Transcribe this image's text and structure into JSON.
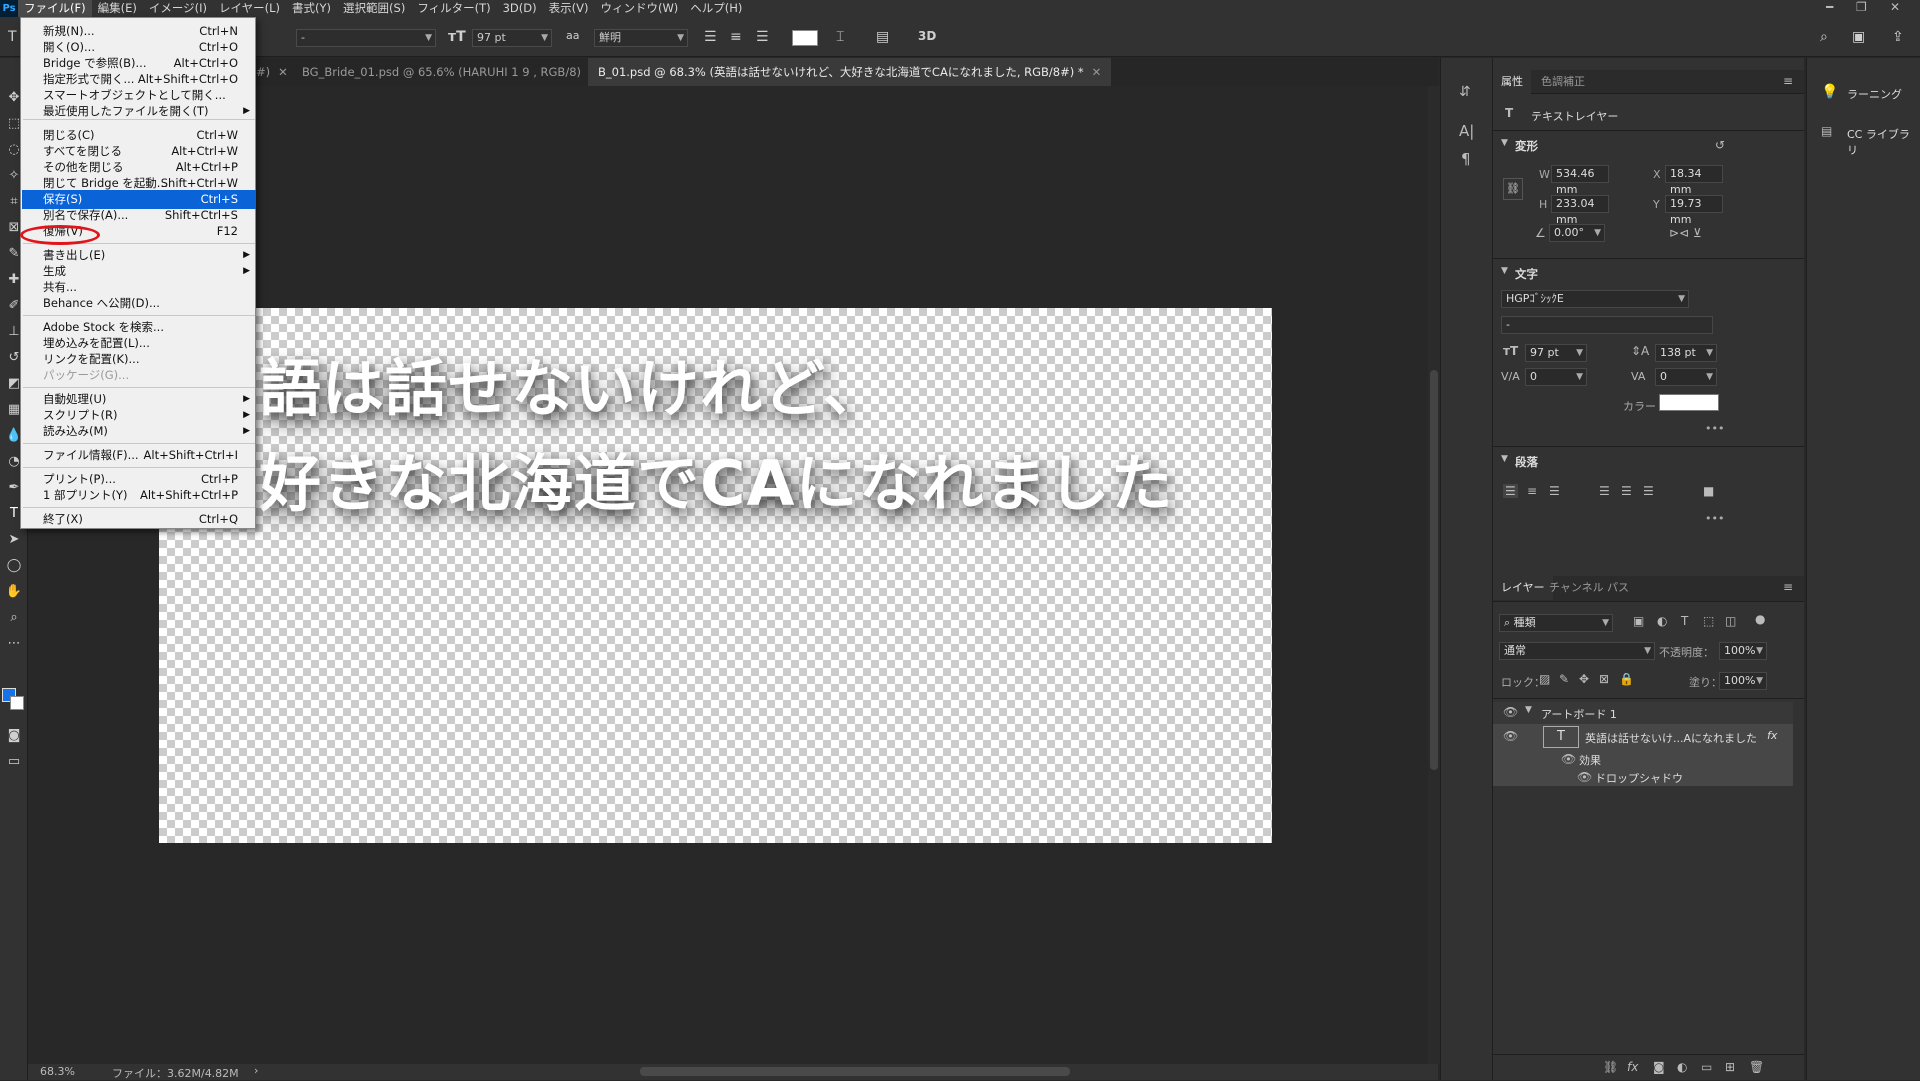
{
  "app": {
    "logo": "Ps"
  },
  "menubar": {
    "items": [
      "ファイル(F)",
      "編集(E)",
      "イメージ(I)",
      "レイヤー(L)",
      "書式(Y)",
      "選択範囲(S)",
      "フィルター(T)",
      "3D(D)",
      "表示(V)",
      "ウィンドウ(W)",
      "ヘルプ(H)"
    ]
  },
  "options": {
    "font_style": "-",
    "size": "97 pt",
    "aa": "鮮明",
    "mode3d": "3D",
    "aa_icon": "aa"
  },
  "tabs": [
    {
      "label": "#)",
      "closable": true
    },
    {
      "label": "BG_Bride_01.psd @ 65.6% (HARUHI 1  9 , RGB/8)",
      "closable": true
    },
    {
      "label": "B_01.psd @ 68.3% (英語は話せないけれど、大好きな北海道でCAになれました, RGB/8#) *",
      "closable": true,
      "active": true
    }
  ],
  "canvas": {
    "line1": "語は話せないけれど、",
    "line2": "好きな北海道でCAになれました"
  },
  "status": {
    "zoom": "68.3%",
    "file": "ファイル：3.62M/4.82M"
  },
  "file_menu": {
    "items": [
      {
        "label": "新規(N)...",
        "shortcut": "Ctrl+N"
      },
      {
        "label": "開く(O)...",
        "shortcut": "Ctrl+O"
      },
      {
        "label": "Bridge で参照(B)...",
        "shortcut": "Alt+Ctrl+O"
      },
      {
        "label": "指定形式で開く...",
        "shortcut": "Alt+Shift+Ctrl+O"
      },
      {
        "label": "スマートオブジェクトとして開く...",
        "shortcut": ""
      },
      {
        "label": "最近使用したファイルを開く(T)",
        "shortcut": "",
        "submenu": true
      },
      {
        "label": "閉じる(C)",
        "shortcut": "Ctrl+W"
      },
      {
        "label": "すべてを閉じる",
        "shortcut": "Alt+Ctrl+W"
      },
      {
        "label": "その他を閉じる",
        "shortcut": "Alt+Ctrl+P"
      },
      {
        "label": "閉じて Bridge を起動...",
        "shortcut": "Shift+Ctrl+W"
      },
      {
        "label": "保存(S)",
        "shortcut": "Ctrl+S",
        "highlighted": true
      },
      {
        "label": "別名で保存(A)...",
        "shortcut": "Shift+Ctrl+S"
      },
      {
        "label": "復帰(V)",
        "shortcut": "F12"
      },
      {
        "label": "書き出し(E)",
        "shortcut": "",
        "submenu": true
      },
      {
        "label": "生成",
        "shortcut": "",
        "submenu": true
      },
      {
        "label": "共有...",
        "shortcut": ""
      },
      {
        "label": "Behance へ公開(D)...",
        "shortcut": ""
      },
      {
        "label": "Adobe Stock を検索...",
        "shortcut": ""
      },
      {
        "label": "埋め込みを配置(L)...",
        "shortcut": ""
      },
      {
        "label": "リンクを配置(K)...",
        "shortcut": ""
      },
      {
        "label": "パッケージ(G)...",
        "shortcut": "",
        "disabled": true
      },
      {
        "label": "自動処理(U)",
        "shortcut": "",
        "submenu": true
      },
      {
        "label": "スクリプト(R)",
        "shortcut": "",
        "submenu": true
      },
      {
        "label": "読み込み(M)",
        "shortcut": "",
        "submenu": true
      },
      {
        "label": "ファイル情報(F)...",
        "shortcut": "Alt+Shift+Ctrl+I"
      },
      {
        "label": "プリント(P)...",
        "shortcut": "Ctrl+P"
      },
      {
        "label": "1 部プリント(Y)",
        "shortcut": "Alt+Shift+Ctrl+P"
      },
      {
        "label": "終了(X)",
        "shortcut": "Ctrl+Q"
      }
    ]
  },
  "properties": {
    "tab_props": "属性",
    "tab_adjust": "色調補正",
    "layer_type": "テキストレイヤー",
    "transform_title": "変形",
    "w_label": "W",
    "w": "534.46 mm",
    "h_label": "H",
    "h": "233.04 mm",
    "x_label": "X",
    "x": "18.34 mm",
    "y_label": "Y",
    "y": "19.73 mm",
    "angle": "0.00°",
    "char_title": "文字",
    "font": "HGPｺﾞｼｯｸE",
    "font_style": "-",
    "size": "97 pt",
    "leading": "138 pt",
    "tracking": "0",
    "kerning": "0",
    "color_label": "カラー",
    "color": "#ffffff",
    "para_title": "段落",
    "more": "•••"
  },
  "layers": {
    "tab_layers": "レイヤー",
    "tab_channels": "チャンネル",
    "tab_paths": "パス",
    "filter": "種類",
    "blend": "通常",
    "opacity_label": "不透明度：",
    "opacity": "100%",
    "lock_label": "ロック：",
    "fill_label": "塗り：",
    "fill": "100%",
    "artboard": "アートボード 1",
    "text_layer": "英語は話せないけ...Aになれました",
    "fx": "fx",
    "effects": "効果",
    "dropshadow": "ドロップシャドウ"
  },
  "far_right": {
    "learn": "ラーニング",
    "cclib": "CC ライブラリ"
  }
}
